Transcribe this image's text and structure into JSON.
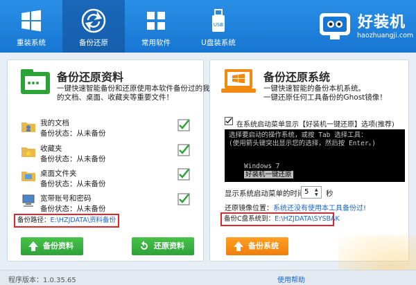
{
  "nav": {
    "items": [
      {
        "label": "重装系统",
        "icon": "windows-icon"
      },
      {
        "label": "备份还原",
        "icon": "sync-icon"
      },
      {
        "label": "常用软件",
        "icon": "apps-grid-icon"
      },
      {
        "label": "U盘装系统",
        "icon": "usb-icon"
      }
    ],
    "active_index": 1
  },
  "brand": {
    "name": "好装机",
    "url": "haozhuangji.com"
  },
  "left_panel": {
    "title": "备份还原资料",
    "desc_line1": "一键快速智能备份和还原使用本软件备份过的我",
    "desc_line2": "的文档、桌面、收藏夹等重要文件！",
    "items": [
      {
        "name": "我的文档",
        "status": "备份状态：从未备份"
      },
      {
        "name": "收藏夹",
        "status": "备份状态：从未备份"
      },
      {
        "name": "桌面文件夹",
        "status": "备份状态：从未备份"
      },
      {
        "name": "宽带账号和密码",
        "status": "备份状态：从未备份"
      }
    ],
    "path_label": "备份路径：",
    "path_value": "E:\\HZJDATA\\资料备份",
    "backup_button": "备份资料",
    "restore_button": "还原资料"
  },
  "right_panel": {
    "title": "备份还原系统",
    "desc_line1": "一键快速智能的备份本机系统。",
    "desc_line2": "一键还原任何工具备份的Ghost镜像！",
    "boot_option": "在系统启动菜单显示【好装机一键还原】选项(推荐)",
    "terminal": {
      "line1": "选择要启动的操作系统，或按 Tab 选择工具：",
      "line2": "(使用箭头键突出显示您的选择，然后按 Enter。)",
      "option1": "Windows 7",
      "option2": "好装机一键还原"
    },
    "timeout_label": "显示系统启动菜单的时间：",
    "timeout_value": "5",
    "timeout_unit": "秒",
    "restore_label": "还原镜像位置：",
    "restore_link": "系统还没有使用本工具备份过!",
    "drive_label": "备份C盘系统到：",
    "drive_value": "E:\\HZJDATA\\SYSBAK",
    "backup_button": "备份系统"
  },
  "footer": {
    "version": "程序版本：1.0.35.65",
    "help": "使用帮助"
  },
  "colors": {
    "header": "#1f84dd",
    "green": "#36b03f",
    "orange": "#f28a12",
    "highlight": "#e0262b"
  }
}
